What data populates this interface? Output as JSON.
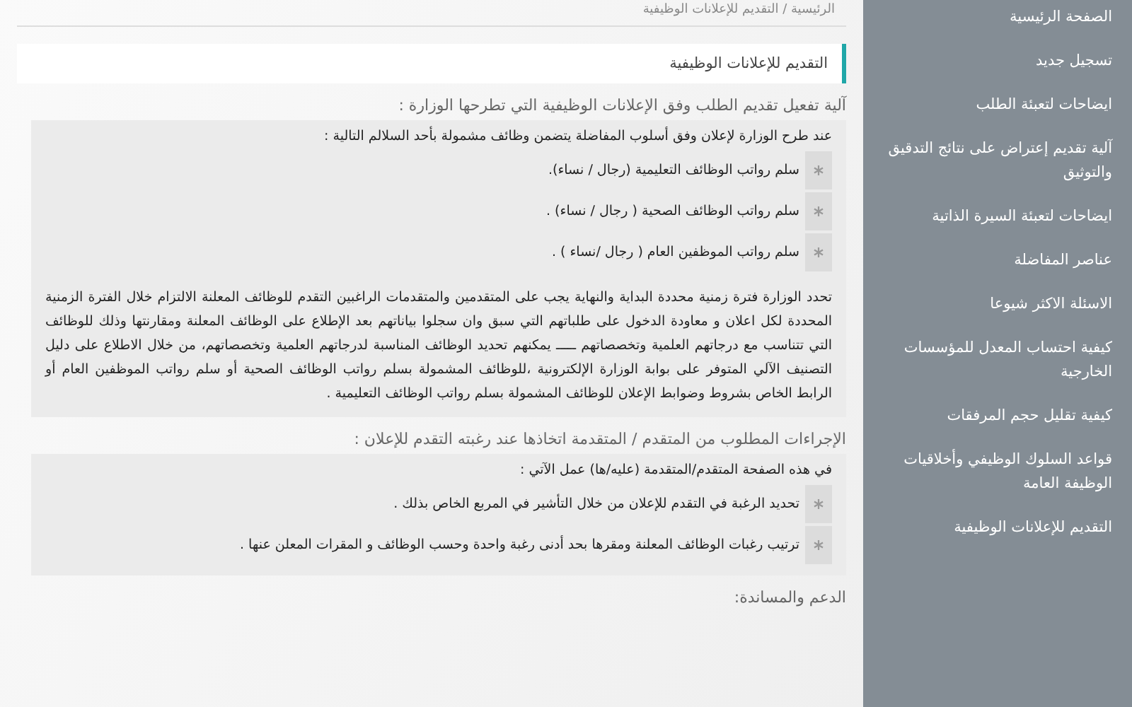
{
  "breadcrumb": "الرئيسية / التقديم للإعلانات الوظيفية",
  "page_title": "التقديم للإعلانات الوظيفية",
  "sections": [
    {
      "heading": "آلية تفعيل تقديم الطلب وفق الإعلانات الوظيفية التي تطرحها الوزارة :",
      "intro": "عند طرح الوزارة لإعلان وفق أسلوب المفاضلة يتضمن وظائف مشمولة بأحد السلالم التالية :",
      "items": [
        "سلم رواتب الوظائف التعليمية (رجال / نساء).",
        "سلم رواتب الوظائف الصحية ( رجال / نساء) .",
        "سلم رواتب الموظفين العام ( رجال /نساء ) ."
      ],
      "paragraph": "تحدد الوزارة فترة زمنية محددة البداية والنهاية يجب على المتقدمين والمتقدمات الراغبين التقدم للوظائف المعلنة الالتزام خلال الفترة الزمنية المحددة لكل اعلان و معاودة الدخول على طلباتهم التي سبق وان سجلوا بياناتهم بعد الإطلاع على الوظائف المعلنة ومقارنتها وذلك للوظائف التي تتناسب مع درجاتهم العلمية وتخصصاتهم ـــــ يمكنهم تحديد الوظائف المناسبة لدرجاتهم العلمية وتخصصاتهم، من خلال الاطلاع على دليل التصنيف الآلي المتوفر على بوابة الوزارة الإلكترونية ،للوظائف المشمولة بسلم رواتب الوظائف الصحية أو سلم رواتب الموظفين العام أو الرابط الخاص بشروط وضوابط الإعلان للوظائف المشمولة بسلم رواتب الوظائف التعليمية ."
    },
    {
      "heading": "الإجراءات المطلوب من المتقدم / المتقدمة اتخاذها عند رغبته التقدم للإعلان :",
      "intro": "في هذه الصفحة المتقدم/المتقدمة (عليه/ها) عمل الآتي :",
      "items": [
        "تحديد الرغبة في التقدم للإعلان من خلال التأشير في المربع الخاص بذلك .",
        "ترتيب رغبات الوظائف المعلنة ومقرها بحد أدنى رغبة واحدة وحسب الوظائف و المقرات المعلن عنها ."
      ]
    },
    {
      "heading": "الدعم والمساندة:"
    }
  ],
  "sidebar": {
    "items": [
      "الصفحة الرئيسية",
      "تسجيل جديد",
      "ايضاحات لتعبئة الطلب",
      "آلية تقديم إعتراض على نتائج التدقيق والتوثيق",
      "ايضاحات لتعبئة السيرة الذاتية",
      "عناصر المفاضلة",
      "الاسئلة الاكثر شيوعا",
      "كيفية احتساب المعدل للمؤسسات الخارجية",
      "كيفية تقليل حجم المرفقات",
      "قواعد السلوك الوظيفي وأخلاقيات الوظيفة العامة",
      "التقديم للإعلانات الوظيفية"
    ]
  }
}
